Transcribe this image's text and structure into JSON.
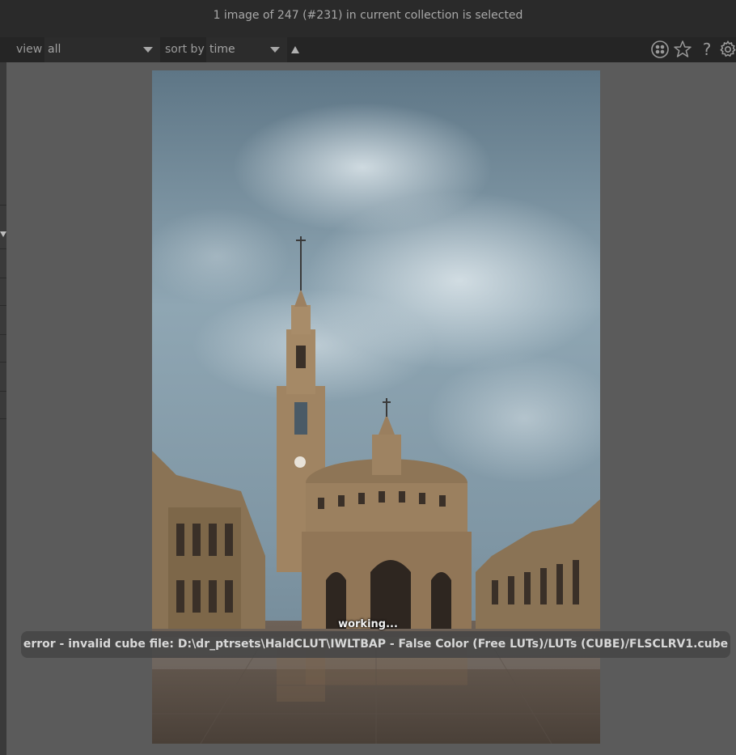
{
  "header": {
    "status": "1 image of 247 (#231) in current collection is selected"
  },
  "filter_bar": {
    "view_label": "view",
    "view_value": "all",
    "sort_label": "sort by",
    "sort_value": "time",
    "sort_direction_icon": "triangle-up-icon",
    "right_icons": [
      "color-labels-icon",
      "star-icon",
      "help-icon",
      "gear-icon"
    ],
    "help_glyph": "?"
  },
  "center": {
    "image_subject": "photograph-tall-stone-tower-and-domed-building-under-cloudy-sky",
    "working_message": "working...",
    "error_message": "error - invalid cube file: D:\\dr_ptrsets\\HaldCLUT\\IWLTBAP - False Color (Free LUTs)/LUTs (CUBE)/FLSCLRV1.cube"
  },
  "colors": {
    "header_bg": "#2a2a2a",
    "filter_bg": "#252525",
    "center_bg": "#5b5b5b",
    "toast_bg": "#464646"
  }
}
